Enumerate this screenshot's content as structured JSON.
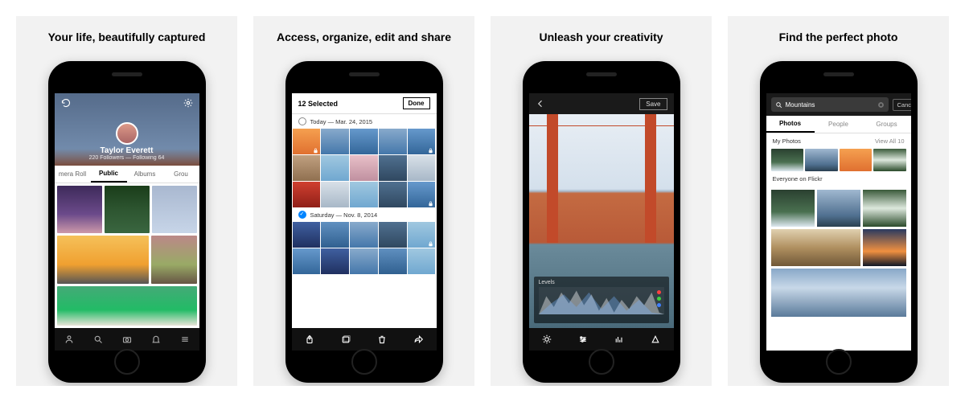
{
  "panels": [
    {
      "title": "Your life, beautifully captured"
    },
    {
      "title": "Access, organize, edit and share"
    },
    {
      "title": "Unleash your creativity"
    },
    {
      "title": "Find the perfect photo"
    }
  ],
  "profile": {
    "name": "Taylor Everett",
    "stats": "220 Followers — Following 64",
    "tabs": [
      "mera Roll",
      "Public",
      "Albums",
      "Grou"
    ],
    "active_tab": "Public",
    "bottom_icons": [
      "person-icon",
      "search-icon",
      "camera-icon",
      "bell-icon",
      "menu-icon"
    ]
  },
  "organize": {
    "selected_label": "12 Selected",
    "done_label": "Done",
    "groups": [
      {
        "label": "Today — Mar. 24, 2015",
        "checked": false
      },
      {
        "label": "Saturday — Nov. 8, 2014",
        "checked": true
      }
    ],
    "bottom_icons": [
      "share-icon",
      "album-icon",
      "trash-icon",
      "forward-icon"
    ]
  },
  "edit": {
    "save_label": "Save",
    "tool_label": "Levels",
    "dot_colors": [
      "#ff4040",
      "#40d040",
      "#4080ff"
    ],
    "bottom_icons": [
      "brightness-icon",
      "sliders-icon",
      "histogram-icon",
      "crop-icon"
    ]
  },
  "search": {
    "query": "Mountains",
    "placeholder": "Search",
    "cancel_label": "Cancel",
    "tabs": [
      "Photos",
      "People",
      "Groups"
    ],
    "active_tab": "Photos",
    "sections": {
      "mine_label": "My Photos",
      "mine_view": "View All 10",
      "everyone_label": "Everyone on Flickr"
    }
  }
}
